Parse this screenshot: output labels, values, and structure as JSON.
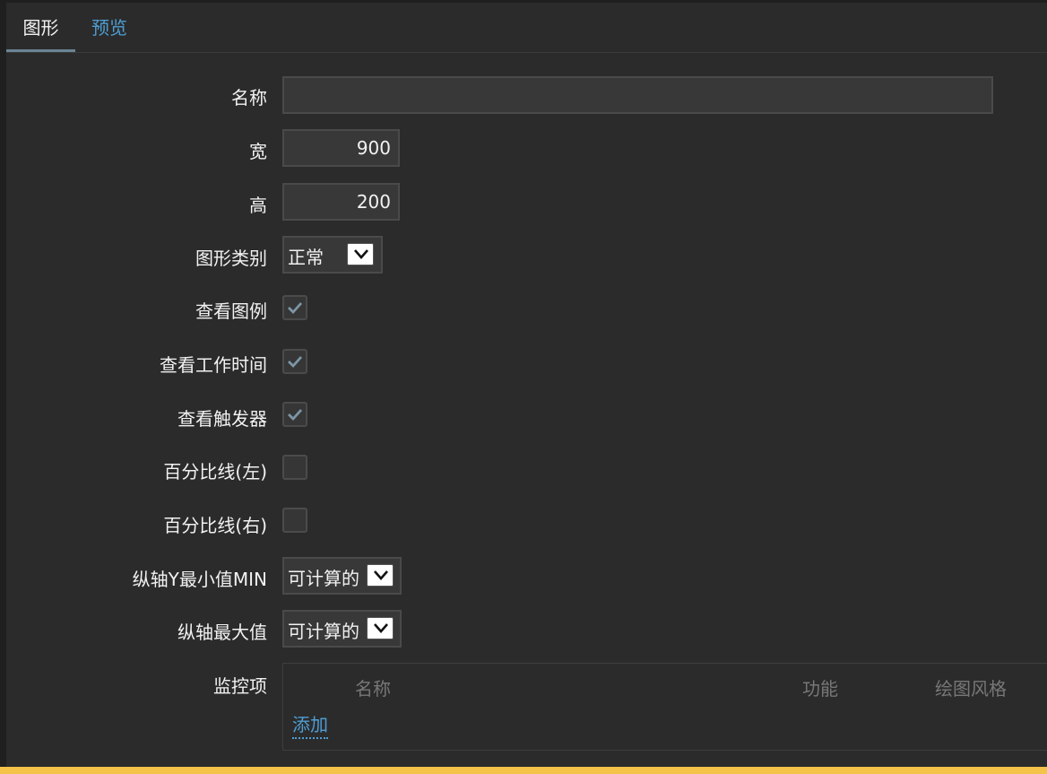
{
  "tabs": [
    {
      "label": "图形",
      "active": true
    },
    {
      "label": "预览",
      "active": false
    }
  ],
  "form": {
    "name": {
      "label": "名称",
      "value": ""
    },
    "width": {
      "label": "宽",
      "value": "900"
    },
    "height": {
      "label": "高",
      "value": "200"
    },
    "graph_type": {
      "label": "图形类别",
      "value": "正常"
    },
    "show_legend": {
      "label": "查看图例",
      "checked": true
    },
    "show_working_time": {
      "label": "查看工作时间",
      "checked": true
    },
    "show_triggers": {
      "label": "查看触发器",
      "checked": true
    },
    "percentile_left": {
      "label": "百分比线(左)",
      "checked": false
    },
    "percentile_right": {
      "label": "百分比线(右)",
      "checked": false
    },
    "y_min": {
      "label": "纵轴Y最小值MIN",
      "value": "可计算的"
    },
    "y_max": {
      "label": "纵轴最大值",
      "value": "可计算的"
    },
    "items": {
      "label": "监控项",
      "columns": [
        "名称",
        "功能",
        "绘图风格"
      ],
      "add_label": "添加"
    }
  },
  "colors": {
    "background": "#2b2b2b",
    "link": "#4e9ed4",
    "checkmark": "#7d96a6",
    "bottom_bar": "#f4c34a"
  }
}
